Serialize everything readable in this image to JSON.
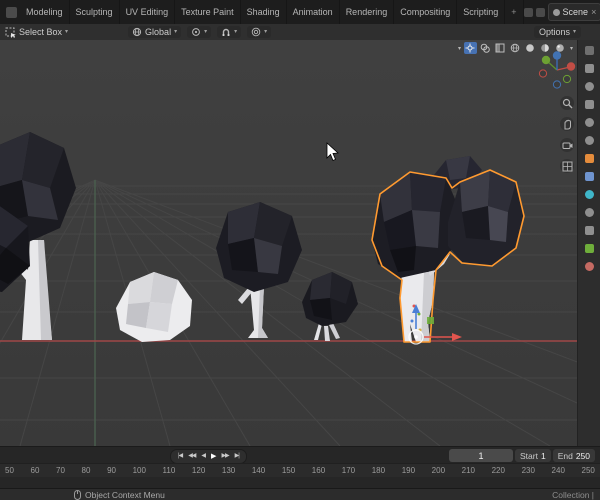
{
  "topbar": {
    "tabs": [
      "Modeling",
      "Sculpting",
      "UV Editing",
      "Texture Paint",
      "Shading",
      "Animation",
      "Rendering",
      "Compositing",
      "Scripting"
    ],
    "add_workspace": "+",
    "scene": {
      "label": "Scene",
      "clear": "×"
    }
  },
  "tool_settings": {
    "tool": {
      "label": "Select Box",
      "caret": "▾"
    },
    "orientation": {
      "label": "Global",
      "caret": "▾"
    },
    "pivot_caret": "▾",
    "snap_caret": "▾",
    "falloff_caret": "▾",
    "options": {
      "label": "Options",
      "caret": "▾"
    }
  },
  "viewport": {
    "header_caret": "▾",
    "header_icons": [
      "show-gizmos",
      "show-overlays",
      "toggle-xray",
      "wireframe-shading",
      "solid-shading",
      "material-preview-shading",
      "rendered-shading"
    ],
    "active_icon": "show-gizmos",
    "side_controls": [
      "zoom",
      "pan",
      "camera-view",
      "toggle-orthographic"
    ],
    "nav_axes": [
      "X",
      "Y",
      "Z"
    ],
    "objects": [
      "tree-left",
      "cloud",
      "tree-medium",
      "tree-small",
      "tree-selected"
    ],
    "selected_object": "tree-selected"
  },
  "properties_rail": {
    "tabs": [
      "tool",
      "render",
      "output",
      "view-layer",
      "scene",
      "world",
      "object",
      "modifiers",
      "particles",
      "physics",
      "constraints",
      "object-data",
      "material"
    ]
  },
  "timeline": {
    "playback": [
      {
        "name": "jump-to-start",
        "glyph": "|◀"
      },
      {
        "name": "previous-keyframe",
        "glyph": "◀◀"
      },
      {
        "name": "play-reverse",
        "glyph": "◀"
      },
      {
        "name": "play",
        "glyph": "▶"
      },
      {
        "name": "next-keyframe",
        "glyph": "▶▶"
      },
      {
        "name": "jump-to-end",
        "glyph": "▶|"
      }
    ],
    "ticks": [
      "50",
      "60",
      "70",
      "80",
      "90",
      "100",
      "110",
      "120",
      "130",
      "140",
      "150",
      "160",
      "170",
      "180",
      "190",
      "200",
      "210",
      "220",
      "230",
      "240",
      "250"
    ],
    "current_frame": "1",
    "start": {
      "label": "Start",
      "value": "1"
    },
    "end": {
      "label": "End",
      "value": "250"
    }
  },
  "status_bar": {
    "hint": "Object Context Menu",
    "collection": "Collection |"
  },
  "colors": {
    "selection_outline": "#ff9a30",
    "x_axis_red": "#9f4747",
    "y_axis_green": "#4a5f4e",
    "active_highlight": "#4772b3",
    "viewport_background": "#3c3c3c"
  }
}
